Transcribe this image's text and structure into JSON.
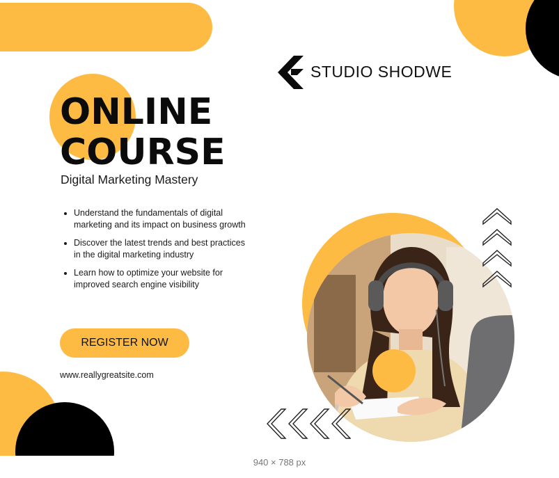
{
  "brand": {
    "name": "STUDIO SHODWE",
    "logo_icon": "stylized-f-logo-icon"
  },
  "hero": {
    "title_line1": "ONLINE",
    "title_line2": "COURSE",
    "subtitle": "Digital Marketing Mastery"
  },
  "bullets": [
    "Understand the fundamentals of digital marketing and its impact on business growth",
    "Discover the latest trends and best practices in the digital marketing industry",
    "Learn how to optimize your website for improved search engine visibility"
  ],
  "cta": {
    "label": "REGISTER NOW"
  },
  "website": "www.reallygreatsite.com",
  "caption": "940 × 788 px",
  "colors": {
    "accent": "#FDBB44",
    "dark": "#000000",
    "background": "#FFFFFF"
  },
  "icons": {
    "up_arrows": "chevron-up-icon",
    "left_arrows": "chevron-left-icon"
  }
}
